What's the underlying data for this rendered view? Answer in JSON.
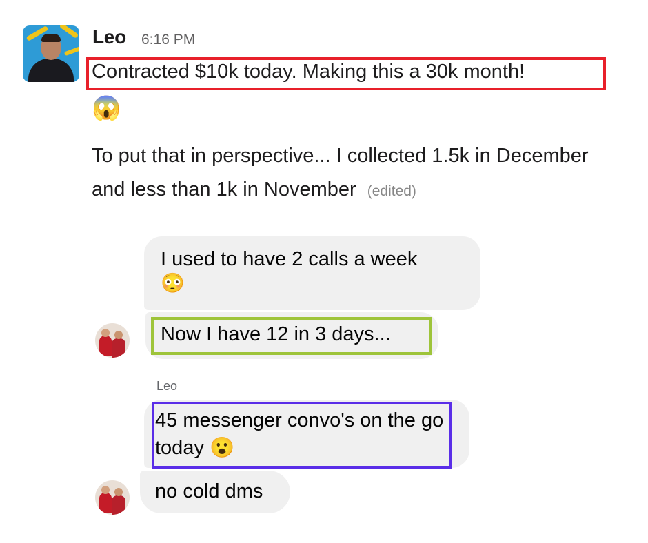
{
  "slack_message": {
    "sender": "Leo",
    "time": "6:16 PM",
    "line1": "Contracted $10k today. Making this a 30k month!",
    "reaction_emoji": "😱",
    "paragraph": "To put that in perspective... I collected 1.5k in December and less than 1k in November",
    "edited_label": "(edited)"
  },
  "messenger_thread": {
    "bubble1_text": "I used to have 2 calls a week",
    "bubble1_emoji": "😳",
    "bubble2_text": "Now I have 12 in 3 days...",
    "sender_label": "Leo",
    "bubble3_text": "45 messenger convo's on the go today",
    "bubble3_emoji": "😮",
    "bubble4_text": "no cold dms"
  },
  "highlight_colors": {
    "red": "#e8202a",
    "green": "#9ec43a",
    "purple": "#5a2ee8"
  },
  "icons": {
    "main_avatar": "profile-photo",
    "small_avatar": "group-photo"
  }
}
